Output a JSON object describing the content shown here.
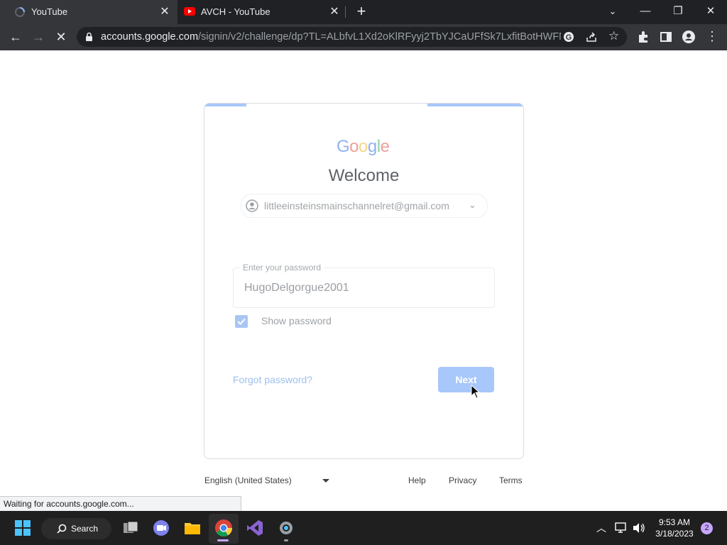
{
  "browser": {
    "tabs": [
      {
        "title": "YouTube",
        "icon": "loading-spinner-icon"
      },
      {
        "title": "AVCH - YouTube",
        "icon": "youtube-icon"
      }
    ],
    "url_host": "accounts.google.com",
    "url_path": "/signin/v2/challenge/dp?TL=ALbfvL1Xd2oKlRFyyj2TbYJCaUFfSk7LxfitBotHWFNcu..."
  },
  "signin": {
    "logo_text": "Google",
    "heading": "Welcome",
    "account_email": "littleeinsteinsmainschannelret@gmail.com",
    "password_label": "Enter your password",
    "password_value": "HugoDelgorgue2001",
    "show_password_label": "Show password",
    "show_password_checked": true,
    "forgot_label": "Forgot password?",
    "next_label": "Next",
    "accent_color": "#a8c7fa"
  },
  "footer": {
    "language": "English (United States)",
    "links": [
      "Help",
      "Privacy",
      "Terms"
    ]
  },
  "status_text": "Waiting for accounts.google.com...",
  "taskbar": {
    "search_label": "Search",
    "time": "9:53 AM",
    "date": "3/18/2023",
    "notification_count": "2"
  }
}
